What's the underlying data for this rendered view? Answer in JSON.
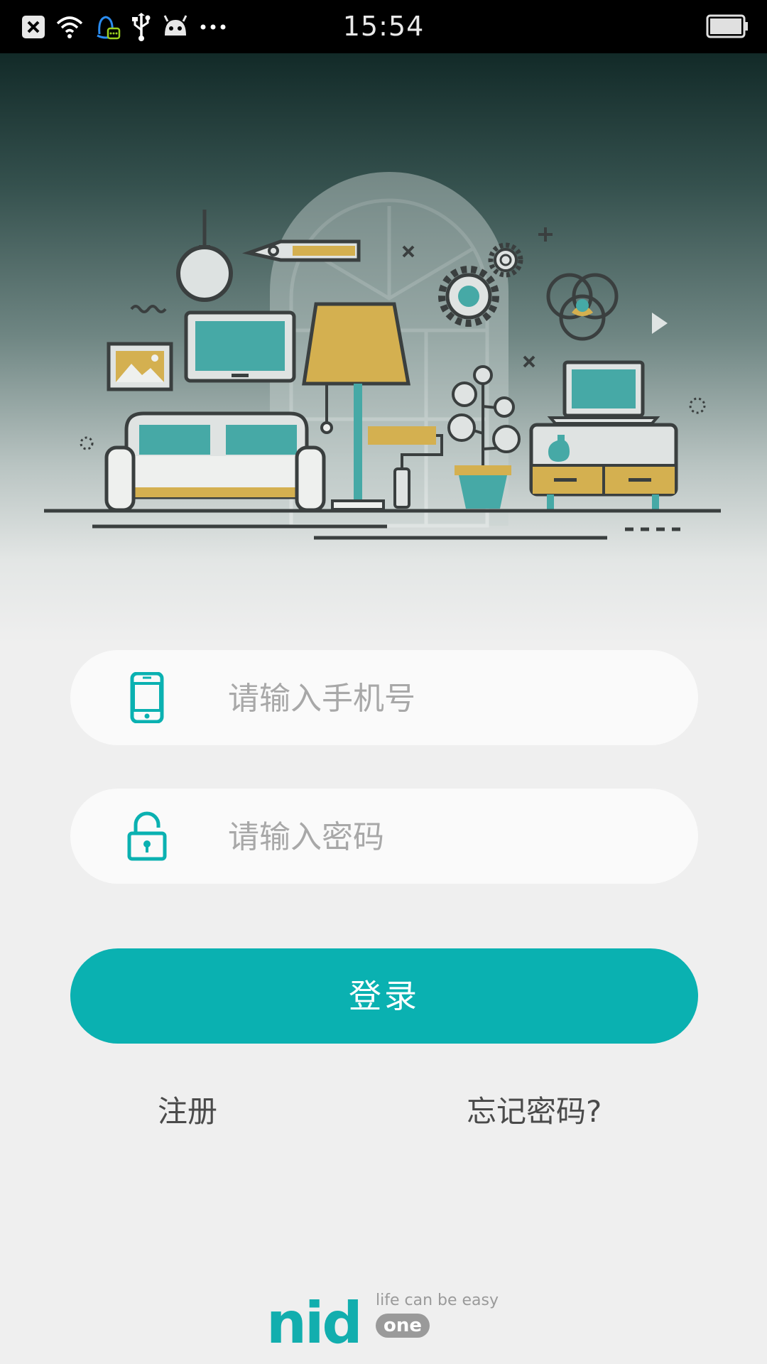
{
  "status_bar": {
    "time": "15:54",
    "icons": [
      "close-notification-icon",
      "wifi-icon",
      "qq-icon",
      "usb-icon",
      "android-icon",
      "more-dots-icon",
      "battery-icon"
    ]
  },
  "login_form": {
    "phone_placeholder": "请输入手机号",
    "password_placeholder": "请输入密码",
    "phone_icon": "phone-icon",
    "password_icon": "unlock-icon",
    "login_label": "登录",
    "register_label": "注册",
    "forgot_label": "忘记密码?"
  },
  "footer": {
    "brand": "nid",
    "tagline": "life can be easy",
    "sub": "one"
  },
  "colors": {
    "accent": "#0ab1b1",
    "mustard": "#d4b050",
    "teal_soft": "#46a9a6"
  }
}
